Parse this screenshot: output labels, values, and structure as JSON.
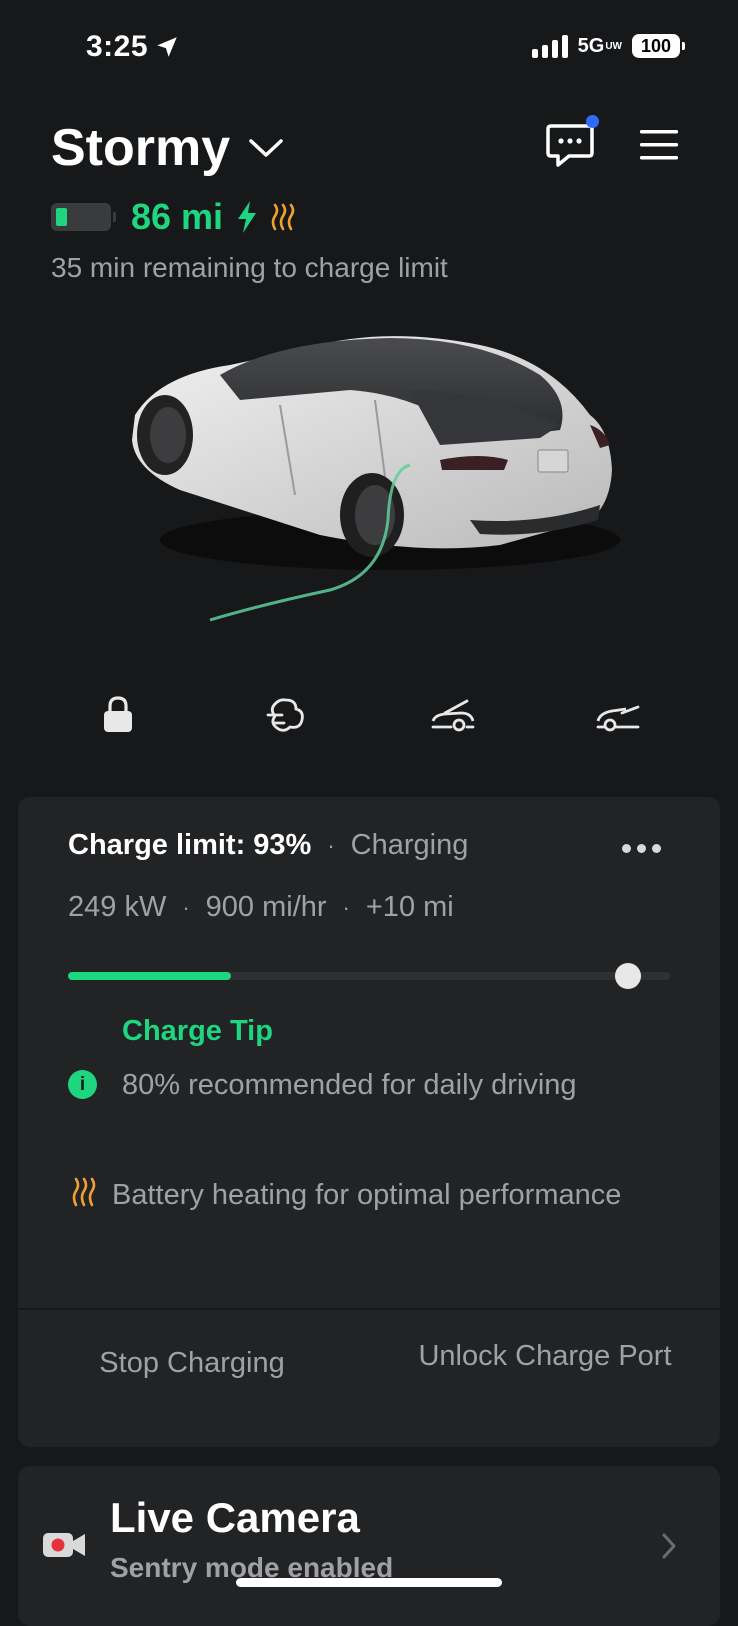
{
  "status_bar": {
    "time": "3:25",
    "network": "5G",
    "network_sup": "UW",
    "battery": "100"
  },
  "header": {
    "car_name": "Stormy",
    "range": "86 mi",
    "charge_remaining": "35 min remaining to charge limit"
  },
  "charging": {
    "limit_label": "Charge limit: 93%",
    "state": "Charging",
    "power": "249 kW",
    "rate": "900 mi/hr",
    "added": "+10 mi",
    "current_fraction": 0.27,
    "limit_percent": 93,
    "tip_title": "Charge Tip",
    "tip_text": "80% recommended for daily driving",
    "heating_text": "Battery heating for optimal performance",
    "stop_label": "Stop Charging",
    "unlock_label": "Unlock Charge Port"
  },
  "live_camera": {
    "title": "Live Camera",
    "subtitle": "Sentry mode enabled"
  },
  "colors": {
    "accent_green": "#1ed67f",
    "heat_orange": "#f0a030",
    "notify_blue": "#2f6bff",
    "record_red": "#e5323a"
  },
  "icons": [
    "location-arrow-icon",
    "signal-icon",
    "chevron-down-icon",
    "message-icon",
    "menu-icon",
    "battery-icon",
    "bolt-icon",
    "heat-icon",
    "lock-icon",
    "fan-icon",
    "frunk-icon",
    "trunk-icon",
    "more-icon",
    "info-icon",
    "camera-icon",
    "chevron-right-icon"
  ]
}
